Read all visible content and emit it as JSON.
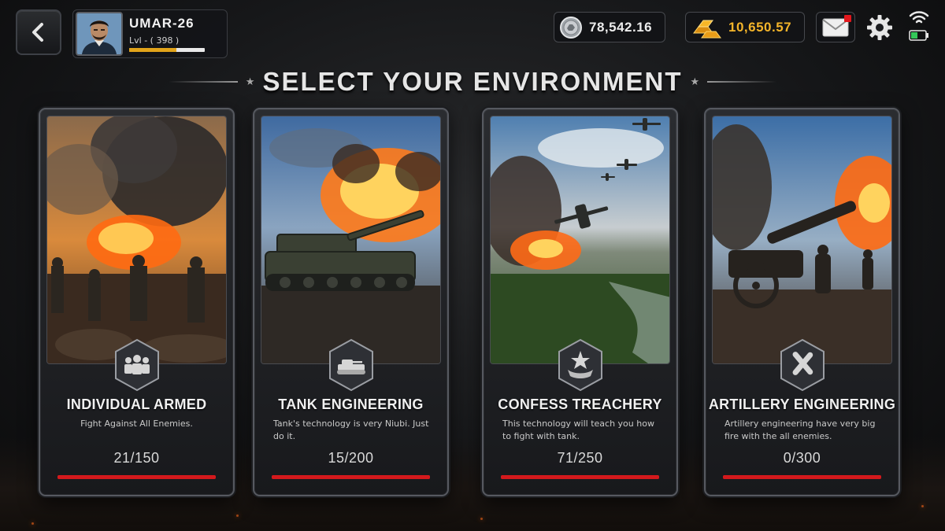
{
  "header": {
    "player": {
      "name": "UMAR-26",
      "level_text": "Lvl - ( 398 )",
      "xp_progress": 0.62
    },
    "currencies": {
      "silver": {
        "icon": "silver-coin-icon",
        "amount": "78,542.16"
      },
      "gold": {
        "icon": "gold-bars-icon",
        "amount": "10,650.57"
      }
    },
    "icons": [
      "back-arrow-icon",
      "mail-icon",
      "gear-icon",
      "wifi-icon",
      "battery-icon"
    ],
    "mail_has_notification": true
  },
  "title": "SELECT YOUR ENVIRONMENT",
  "colors": {
    "accent_red": "#d3191c",
    "gold": "#f3b42a"
  },
  "cards": [
    {
      "title": "INDIVIDUAL ARMED",
      "description": "Fight Against All Enemies.",
      "count": "21/150",
      "icon": "soldiers-group-icon",
      "scene": "infantry-battlefield"
    },
    {
      "title": "TANK ENGINEERING",
      "description": "Tank's technology is very Niubi. Just do it.",
      "count": "15/200",
      "icon": "tank-icon",
      "scene": "tank-explosion"
    },
    {
      "title": "CONFESS TREACHERY",
      "description": "This technology will teach you how to fight with tank.",
      "count": "71/250",
      "icon": "star-emblem-icon",
      "scene": "aircraft-valley"
    },
    {
      "title": "ARTILLERY ENGINEERING",
      "description": "Artillery engineering have very big fire with the all enemies.",
      "count": "0/300",
      "icon": "crossed-shells-icon",
      "scene": "artillery-cannon"
    }
  ]
}
